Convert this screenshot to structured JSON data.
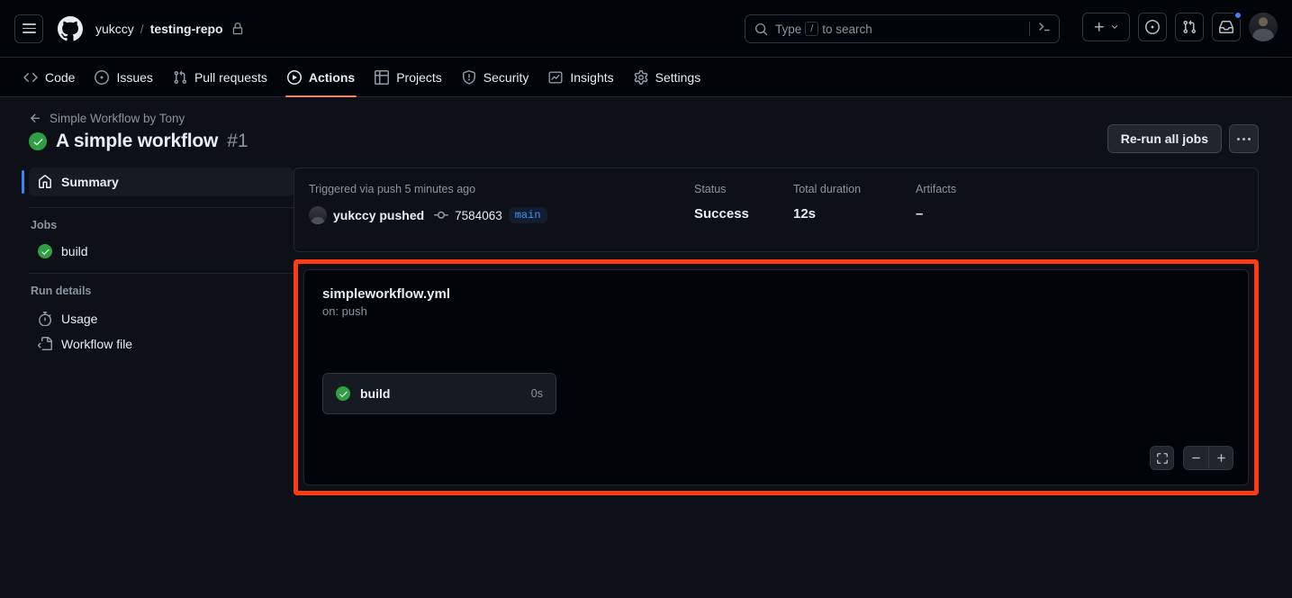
{
  "header": {
    "menu_icon": "hamburger-icon",
    "logo_icon": "github-logo-icon",
    "owner": "yukccy",
    "separator": "/",
    "repo": "testing-repo",
    "repo_visibility_icon": "lock-icon",
    "search": {
      "icon": "search-icon",
      "placeholder_prefix": "Type",
      "placeholder_key": "/",
      "placeholder_suffix": "to search",
      "terminal_icon": "terminal-icon"
    },
    "actions": [
      {
        "name": "create-new-button",
        "icon": "plus-icon",
        "caret": "chevron-down-icon"
      },
      {
        "name": "issues-button",
        "icon": "issue-opened-icon"
      },
      {
        "name": "pull-requests-button",
        "icon": "git-pull-request-icon"
      },
      {
        "name": "notifications-button",
        "icon": "inbox-icon",
        "has_unread": true
      }
    ],
    "avatar": "user-avatar"
  },
  "repo_nav": {
    "tabs": [
      {
        "label": "Code",
        "icon": "code-icon",
        "active": false
      },
      {
        "label": "Issues",
        "icon": "issue-opened-icon",
        "active": false
      },
      {
        "label": "Pull requests",
        "icon": "git-pull-request-icon",
        "active": false
      },
      {
        "label": "Actions",
        "icon": "play-icon",
        "active": true
      },
      {
        "label": "Projects",
        "icon": "table-icon",
        "active": false
      },
      {
        "label": "Security",
        "icon": "shield-icon",
        "active": false
      },
      {
        "label": "Insights",
        "icon": "graph-icon",
        "active": false
      },
      {
        "label": "Settings",
        "icon": "gear-icon",
        "active": false
      }
    ],
    "active_underline_color": "#f78166"
  },
  "run": {
    "back_label": "Simple Workflow by Tony",
    "back_icon": "arrow-left-icon",
    "status_icon": "check-circle-icon",
    "title": "A simple workflow",
    "number": "#1",
    "rerun_label": "Re-run all jobs",
    "more_label": "kebab-menu"
  },
  "sidebar": {
    "summary": {
      "label": "Summary",
      "icon": "home-icon",
      "active": true
    },
    "jobs_heading": "Jobs",
    "jobs": [
      {
        "label": "build",
        "status_icon": "check-circle-icon"
      }
    ],
    "run_details_heading": "Run details",
    "details": [
      {
        "label": "Usage",
        "icon": "stopwatch-icon"
      },
      {
        "label": "Workflow file",
        "icon": "file-code-icon"
      }
    ]
  },
  "summary": {
    "trigger": {
      "label": "Triggered via push 5 minutes ago",
      "actor": "yukccy pushed",
      "commit_icon": "git-commit-icon",
      "commit_sha": "7584063",
      "branch": "main"
    },
    "status": {
      "label": "Status",
      "value": "Success"
    },
    "duration": {
      "label": "Total duration",
      "value": "12s"
    },
    "artifacts": {
      "label": "Artifacts",
      "value": "–"
    }
  },
  "graph": {
    "filename": "simpleworkflow.yml",
    "trigger_text": "on: push",
    "nodes": [
      {
        "label": "build",
        "status_icon": "check-circle-icon",
        "duration": "0s"
      }
    ],
    "controls": {
      "fit_icon": "fit-screen-icon",
      "zoom_out_icon": "minus-icon",
      "zoom_in_icon": "plus-icon"
    },
    "highlight_color": "#fd3b14"
  }
}
